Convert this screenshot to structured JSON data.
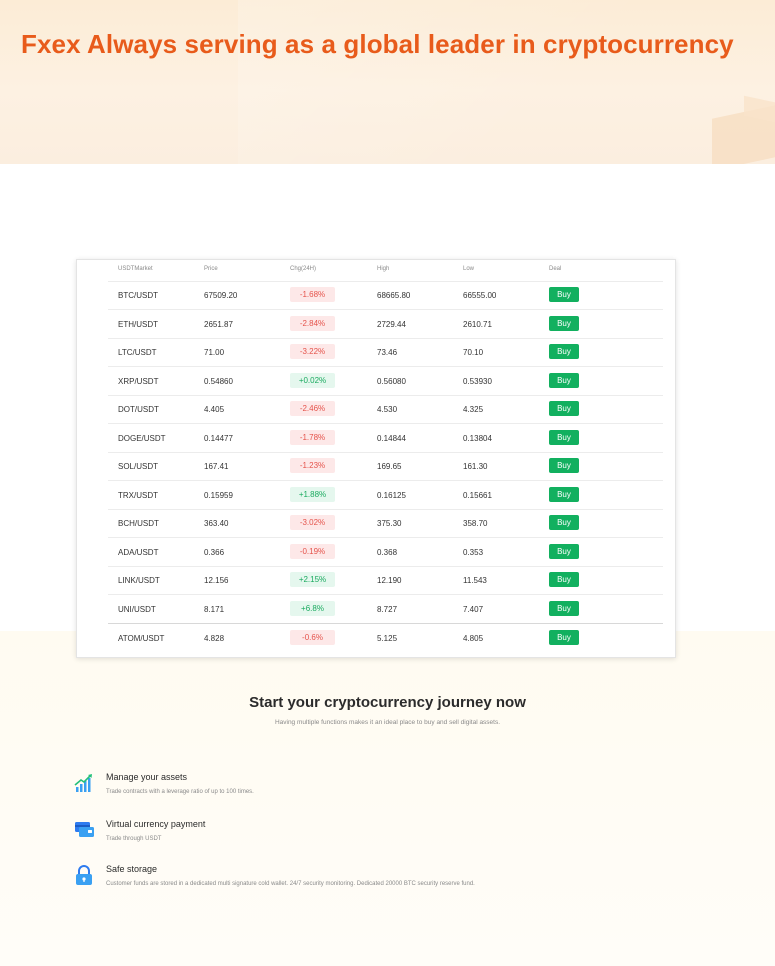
{
  "hero": {
    "title": "Fxex Always serving as a global leader in cryptocurrency"
  },
  "market": {
    "columns": [
      "USDTMarket",
      "Price",
      "Chg(24H)",
      "High",
      "Low",
      "Deal"
    ],
    "rows": [
      {
        "pair": "BTC/USDT",
        "price": "67509.20",
        "change": "-1.68%",
        "high": "68665.80",
        "low": "66555.00",
        "deal": "Buy"
      },
      {
        "pair": "ETH/USDT",
        "price": "2651.87",
        "change": "-2.84%",
        "high": "2729.44",
        "low": "2610.71",
        "deal": "Buy"
      },
      {
        "pair": "LTC/USDT",
        "price": "71.00",
        "change": "-3.22%",
        "high": "73.46",
        "low": "70.10",
        "deal": "Buy"
      },
      {
        "pair": "XRP/USDT",
        "price": "0.54860",
        "change": "+0.02%",
        "high": "0.56080",
        "low": "0.53930",
        "deal": "Buy"
      },
      {
        "pair": "DOT/USDT",
        "price": "4.405",
        "change": "-2.46%",
        "high": "4.530",
        "low": "4.325",
        "deal": "Buy"
      },
      {
        "pair": "DOGE/USDT",
        "price": "0.14477",
        "change": "-1.78%",
        "high": "0.14844",
        "low": "0.13804",
        "deal": "Buy"
      },
      {
        "pair": "SOL/USDT",
        "price": "167.41",
        "change": "-1.23%",
        "high": "169.65",
        "low": "161.30",
        "deal": "Buy"
      },
      {
        "pair": "TRX/USDT",
        "price": "0.15959",
        "change": "+1.88%",
        "high": "0.16125",
        "low": "0.15661",
        "deal": "Buy"
      },
      {
        "pair": "BCH/USDT",
        "price": "363.40",
        "change": "-3.02%",
        "high": "375.30",
        "low": "358.70",
        "deal": "Buy"
      },
      {
        "pair": "ADA/USDT",
        "price": "0.366",
        "change": "-0.19%",
        "high": "0.368",
        "low": "0.353",
        "deal": "Buy"
      },
      {
        "pair": "LINK/USDT",
        "price": "12.156",
        "change": "+2.15%",
        "high": "12.190",
        "low": "11.543",
        "deal": "Buy"
      },
      {
        "pair": "UNI/USDT",
        "price": "8.171",
        "change": "+6.8%",
        "high": "8.727",
        "low": "7.407",
        "deal": "Buy"
      },
      {
        "pair": "ATOM/USDT",
        "price": "4.828",
        "change": "-0.6%",
        "high": "5.125",
        "low": "4.805",
        "deal": "Buy"
      }
    ]
  },
  "journey": {
    "title": "Start your cryptocurrency journey now",
    "subtitle": "Having multiple functions makes it an ideal place to buy and sell digital assets."
  },
  "features": [
    {
      "icon": "chart-growth-icon",
      "title": "Manage your assets",
      "desc": "Trade contracts with a leverage ratio of up to 100 times."
    },
    {
      "icon": "payment-card-icon",
      "title": "Virtual currency payment",
      "desc": "Trade through USDT"
    },
    {
      "icon": "lock-icon",
      "title": "Safe storage",
      "desc": "Customer funds are stored in a dedicated multi signature cold wallet. 24/7 security monitoring. Dedicated 20000 BTC security reserve fund."
    }
  ],
  "colors": {
    "brand_orange": "#e85b1b",
    "buy_green": "#12b05f",
    "negative_red": "#e5534b",
    "positive_green": "#1aaa5f"
  }
}
